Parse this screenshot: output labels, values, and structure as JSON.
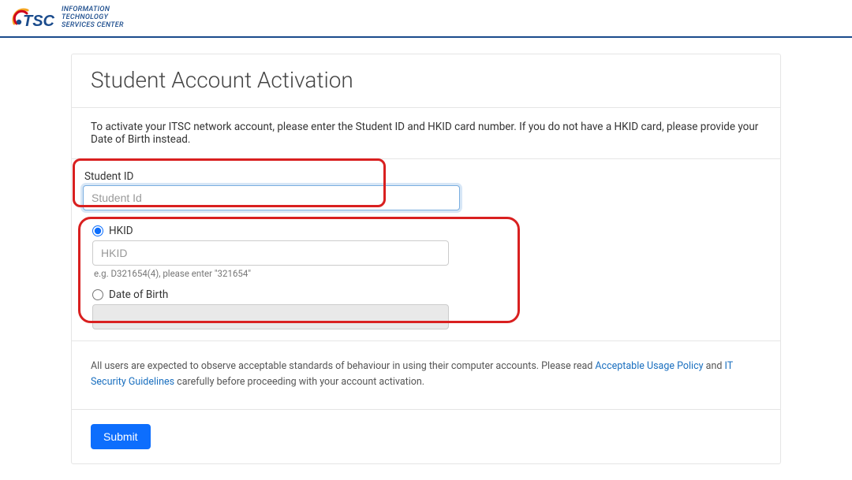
{
  "brand": {
    "line1": "INFORMATION",
    "line2": "TECHNOLOGY",
    "line3": "SERVICES CENTER"
  },
  "page": {
    "title": "Student Account Activation",
    "instruction": "To activate your ITSC network account, please enter the Student ID and HKID card number. If you do not have a HKID card, please provide your Date of Birth instead."
  },
  "form": {
    "student_id_label": "Student ID",
    "student_id_placeholder": "Student Id",
    "student_id_value": "",
    "hkid_radio_label": "HKID",
    "hkid_placeholder": "HKID",
    "hkid_value": "",
    "hkid_hint": "e.g. D321654(4), please enter \"321654\"",
    "dob_radio_label": "Date of Birth",
    "dob_value": "",
    "selected_id_type": "hkid"
  },
  "policy": {
    "pre": "All users are expected to observe acceptable standards of behaviour in using their computer accounts. Please read ",
    "link1": "Acceptable Usage Policy",
    "mid": " and ",
    "link2": "IT Security Guidelines",
    "post": " carefully before proceeding with your account activation."
  },
  "buttons": {
    "submit": "Submit"
  }
}
